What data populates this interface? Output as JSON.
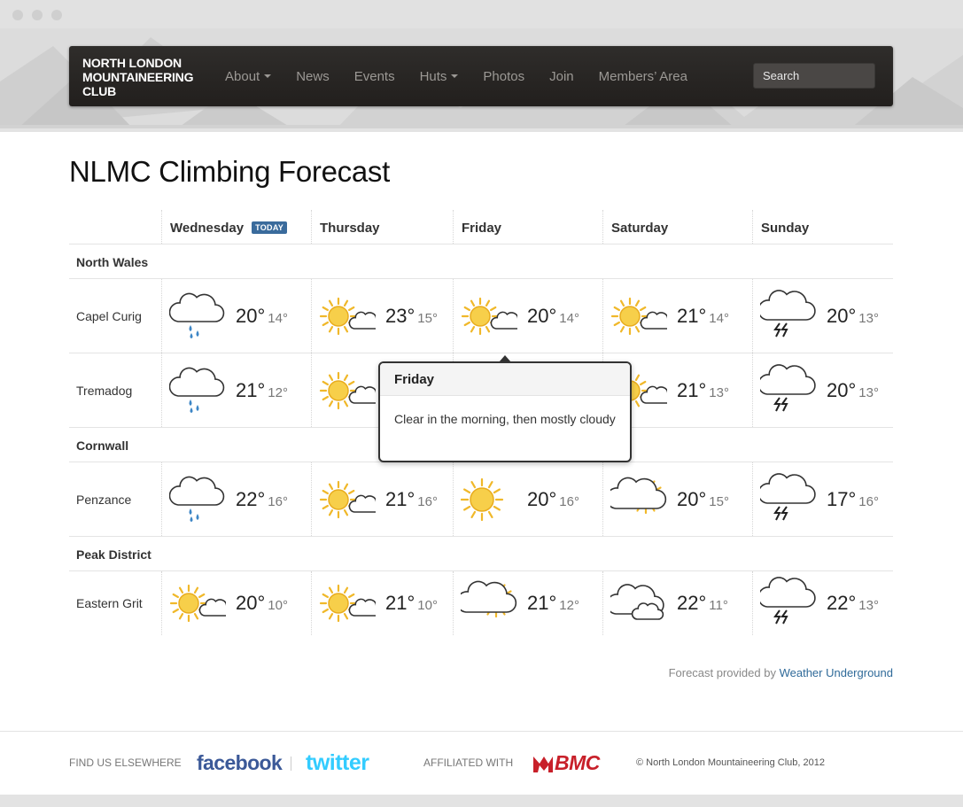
{
  "brand": [
    "NORTH LONDON",
    "MOUNTAINEERING",
    "CLUB"
  ],
  "nav": [
    {
      "label": "About",
      "dropdown": true
    },
    {
      "label": "News",
      "dropdown": false
    },
    {
      "label": "Events",
      "dropdown": false
    },
    {
      "label": "Huts",
      "dropdown": true
    },
    {
      "label": "Photos",
      "dropdown": false
    },
    {
      "label": "Join",
      "dropdown": false
    },
    {
      "label": "Members’ Area",
      "dropdown": false
    }
  ],
  "search": {
    "placeholder": "Search"
  },
  "title": "NLMC Climbing Forecast",
  "today_badge": "TODAY",
  "days": [
    "Wednesday",
    "Thursday",
    "Friday",
    "Saturday",
    "Sunday"
  ],
  "regions": [
    {
      "name": "North Wales",
      "locations": [
        {
          "name": "Capel Curig",
          "forecast": [
            {
              "icon": "rain",
              "hi": "20°",
              "lo": "14°"
            },
            {
              "icon": "partly-cloudy",
              "hi": "23°",
              "lo": "15°"
            },
            {
              "icon": "partly-cloudy",
              "hi": "20°",
              "lo": "14°"
            },
            {
              "icon": "partly-cloudy",
              "hi": "21°",
              "lo": "14°"
            },
            {
              "icon": "thunder",
              "hi": "20°",
              "lo": "13°"
            }
          ]
        },
        {
          "name": "Tremadog",
          "forecast": [
            {
              "icon": "rain",
              "hi": "21°",
              "lo": "12°"
            },
            {
              "icon": "partly-cloudy",
              "hi": "",
              "lo": ""
            },
            {
              "icon": "none",
              "hi": "",
              "lo": ""
            },
            {
              "icon": "partly-cloudy",
              "hi": "21°",
              "lo": "13°"
            },
            {
              "icon": "thunder",
              "hi": "20°",
              "lo": "13°"
            }
          ]
        }
      ]
    },
    {
      "name": "Cornwall",
      "locations": [
        {
          "name": "Penzance",
          "forecast": [
            {
              "icon": "rain",
              "hi": "22°",
              "lo": "16°"
            },
            {
              "icon": "partly-cloudy",
              "hi": "21°",
              "lo": "16°"
            },
            {
              "icon": "sunny",
              "hi": "20°",
              "lo": "16°"
            },
            {
              "icon": "mostly-cloudy",
              "hi": "20°",
              "lo": "15°"
            },
            {
              "icon": "thunder",
              "hi": "17°",
              "lo": "16°"
            }
          ]
        }
      ]
    },
    {
      "name": "Peak District",
      "locations": [
        {
          "name": "Eastern Grit",
          "forecast": [
            {
              "icon": "partly-cloudy",
              "hi": "20°",
              "lo": "10°"
            },
            {
              "icon": "partly-cloudy",
              "hi": "21°",
              "lo": "10°"
            },
            {
              "icon": "mostly-cloudy",
              "hi": "21°",
              "lo": "12°"
            },
            {
              "icon": "cloudy",
              "hi": "22°",
              "lo": "11°"
            },
            {
              "icon": "thunder",
              "hi": "22°",
              "lo": "13°"
            }
          ]
        }
      ]
    }
  ],
  "tooltip": {
    "title": "Friday",
    "body": "Clear in the morning, then mostly cloudy"
  },
  "credit": {
    "text": "Forecast provided by",
    "link": "Weather Underground"
  },
  "footer": {
    "find_us": "FIND US ELSEWHERE",
    "facebook": "facebook",
    "twitter": "twitter",
    "affiliated": "AFFILIATED WITH",
    "bmc": "BMC",
    "copyright": "© North London Mountaineering Club, 2012"
  },
  "colors": {
    "sun": "#f3c233",
    "link": "#2f6a99",
    "today_badge": "#3a6b9c",
    "facebook": "#3b5998",
    "twitter": "#33ccff",
    "bmc": "#c8202a"
  }
}
